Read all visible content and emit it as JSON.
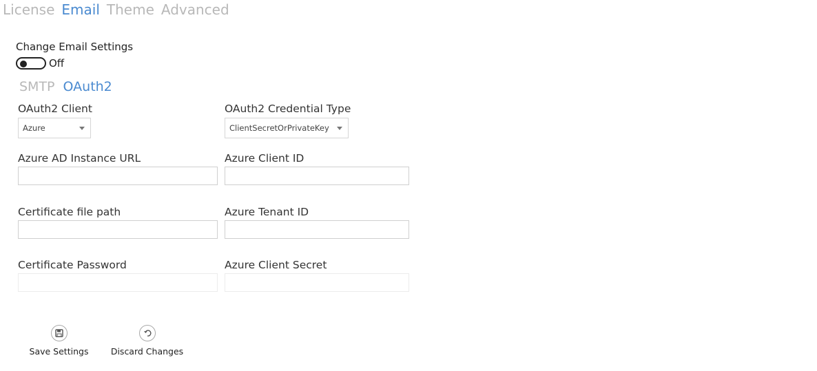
{
  "tabs": [
    {
      "label": "License",
      "active": false
    },
    {
      "label": "Email",
      "active": true
    },
    {
      "label": "Theme",
      "active": false
    },
    {
      "label": "Advanced",
      "active": false
    }
  ],
  "email_settings": {
    "label": "Change Email Settings",
    "toggle_state": "Off"
  },
  "subtabs": [
    {
      "label": "SMTP",
      "active": false
    },
    {
      "label": "OAuth2",
      "active": true
    }
  ],
  "form": {
    "oauth2_client": {
      "label": "OAuth2 Client",
      "value": "Azure"
    },
    "credential_type": {
      "label": "OAuth2 Credential Type",
      "value": "ClientSecretOrPrivateKey"
    },
    "instance_url": {
      "label": "Azure AD Instance URL",
      "value": ""
    },
    "client_id": {
      "label": "Azure Client ID",
      "value": ""
    },
    "cert_path": {
      "label": "Certificate file path",
      "value": ""
    },
    "tenant_id": {
      "label": "Azure Tenant ID",
      "value": ""
    },
    "cert_password": {
      "label": "Certificate Password",
      "value": ""
    },
    "client_secret": {
      "label": "Azure Client Secret",
      "value": ""
    }
  },
  "actions": {
    "save_label": "Save Settings",
    "discard_label": "Discard Changes",
    "save_icon": "save-icon",
    "discard_icon": "undo-icon"
  },
  "colors": {
    "accent": "#4a8ad0",
    "inactive_tab": "#b8b8b8"
  }
}
